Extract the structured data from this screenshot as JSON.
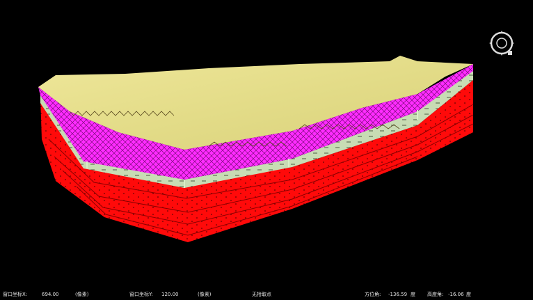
{
  "viewport": {
    "background": "#000000"
  },
  "model_colors": {
    "top_surface": "#e8e08c",
    "magenta_layer": "#ff2cff",
    "pale_green_layer": "#c8dcb4",
    "red_layers": "#ff0a0a"
  },
  "icons": {
    "compass": "rotate-compass-icon"
  },
  "status_bar": {
    "x_label": "窗口坐标X:",
    "x_value": "694.00",
    "x_unit": "(像素)",
    "y_label": "窗口坐标Y:",
    "y_value": "120.00",
    "y_unit": "(像素)",
    "pick_status": "无拾取点",
    "azimuth_label": "方位角:",
    "azimuth_value": "-136.59",
    "azimuth_unit": "度",
    "elevation_label": "高度角:",
    "elevation_value": "-16.06",
    "elevation_unit": "度"
  }
}
